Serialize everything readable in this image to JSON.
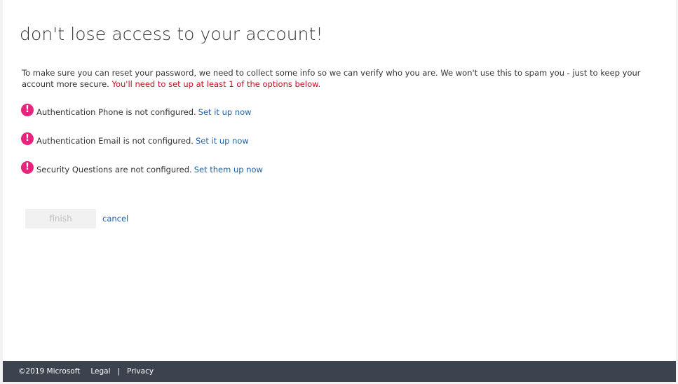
{
  "page": {
    "title": "don't lose access to your account!",
    "intro_text": "To make sure you can reset your password, we need to collect some info so we can verify who you are. We won't use this to spam you - just to keep your account more secure.",
    "intro_warning": "You'll need to set up at least 1 of the options below."
  },
  "methods": [
    {
      "status": "Authentication Phone is not configured.",
      "link": "Set it up now",
      "icon": "exclamation-icon"
    },
    {
      "status": "Authentication Email is not configured.",
      "link": "Set it up now",
      "icon": "exclamation-icon"
    },
    {
      "status": "Security Questions are not configured.",
      "link": "Set them up now",
      "icon": "exclamation-icon"
    }
  ],
  "actions": {
    "finish_label": "finish",
    "cancel_label": "cancel"
  },
  "footer": {
    "copyright": "©2019 Microsoft",
    "legal": "Legal",
    "separator": "|",
    "privacy": "Privacy"
  },
  "colors": {
    "alert": "#e8237e",
    "warning_text": "#c50f1f",
    "link": "#2262a8",
    "footer_bg": "#3c434e"
  }
}
